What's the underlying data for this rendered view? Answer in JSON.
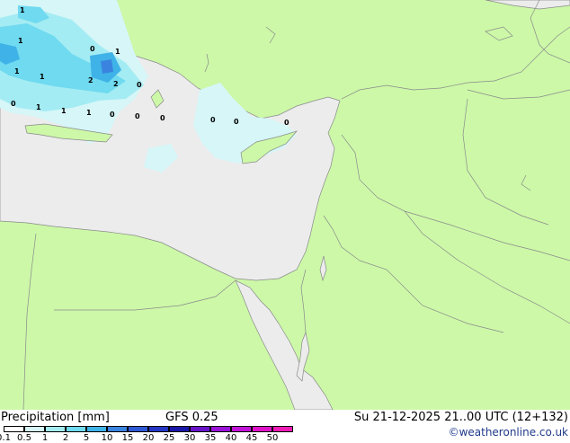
{
  "footer": {
    "title": "Precipitation [mm]",
    "model": "GFS 0.25",
    "datetime": "Su 21-12-2025 21..00 UTC (12+132)",
    "credit": "©weatheronline.co.uk"
  },
  "scale": {
    "ticks": [
      "0.1",
      "0.5",
      "1",
      "2",
      "5",
      "10",
      "15",
      "20",
      "25",
      "30",
      "35",
      "40",
      "45",
      "50"
    ],
    "colors": [
      "#ffffff",
      "#d6f6f8",
      "#a4ecf3",
      "#6fdaf0",
      "#3fb3e8",
      "#3a84e0",
      "#2f5ad6",
      "#2436c4",
      "#1a16a8",
      "#6a12c8",
      "#9a12d8",
      "#c212d6",
      "#e012c8",
      "#f01ab4"
    ]
  },
  "map": {
    "land_color": "#ccf8a8",
    "sea_color": "#ececec",
    "border_color": "#8a8a8a",
    "values": [
      "1",
      "1",
      "0",
      "1",
      "1",
      "1",
      "2",
      "2",
      "0",
      "0",
      "1",
      "1",
      "1",
      "0",
      "0",
      "0",
      "0",
      "0",
      "0"
    ]
  }
}
